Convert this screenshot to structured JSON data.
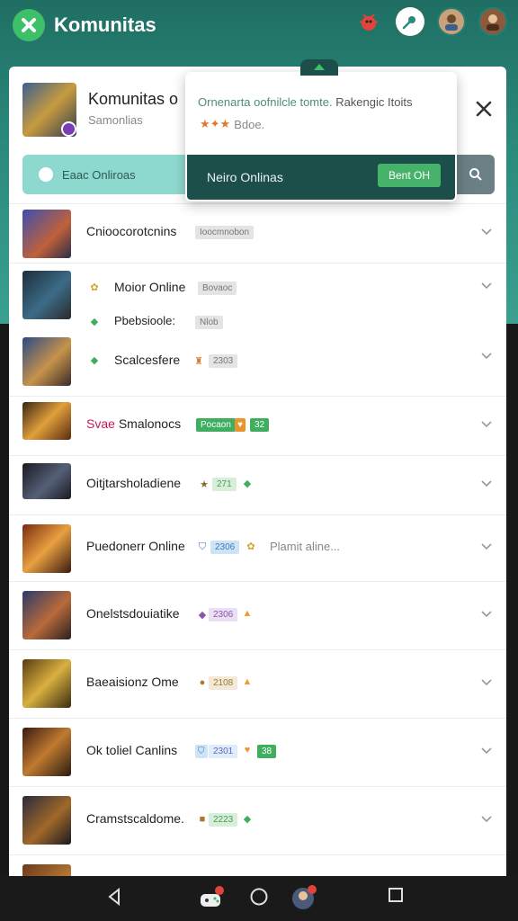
{
  "app": {
    "title": "Komunitas"
  },
  "header": {
    "title": "Komunitas o",
    "subtitle": "Samonlias"
  },
  "popup": {
    "text_green": "Ornenarta oofnilcle tomte.",
    "text_dark": " Rakengic Itoits",
    "rating_label": "Bdoe.",
    "bar_label": "Neiro Onlinas",
    "bar_button": "Bent OH"
  },
  "search": {
    "label": "Eaac Onliroas"
  },
  "rows": [
    {
      "name": "Cnioocorotcnins",
      "tag": "Ioocmnobon"
    },
    {
      "name": "Moior Online",
      "tag": "Bovaoc",
      "name2": "Pbebsioole:",
      "tag2": "Nlob",
      "name3": "Scalcesfere",
      "tag3": "2303"
    },
    {
      "name": "Smalonocs",
      "name_prefix": "Svae",
      "tag": "Pocaon",
      "tag_b": "32"
    },
    {
      "name": "Oitjtarsholadiene",
      "tag": "271"
    },
    {
      "name": "Puedonerr Online",
      "tag": "2306",
      "extra": "Plamit aline..."
    },
    {
      "name": "Onelstsdouiatike",
      "tag": "2306"
    },
    {
      "name": "Baeaisionz Ome",
      "tag": "2108"
    },
    {
      "name": "Ok toliel Canlins",
      "tag": "2301",
      "tag_b": "38"
    },
    {
      "name": "Cramstscaldome.",
      "tag": "2223"
    }
  ],
  "icons": {
    "app": "x-logo-icon",
    "bug": "bug-icon",
    "key": "key-icon",
    "close": "close-icon",
    "search": "search-icon",
    "chevron": "chevron-down-icon"
  },
  "colors": {
    "accent": "#2a8a7c",
    "popup_bar": "#1d4f4a",
    "primary_button": "#46b26a"
  }
}
